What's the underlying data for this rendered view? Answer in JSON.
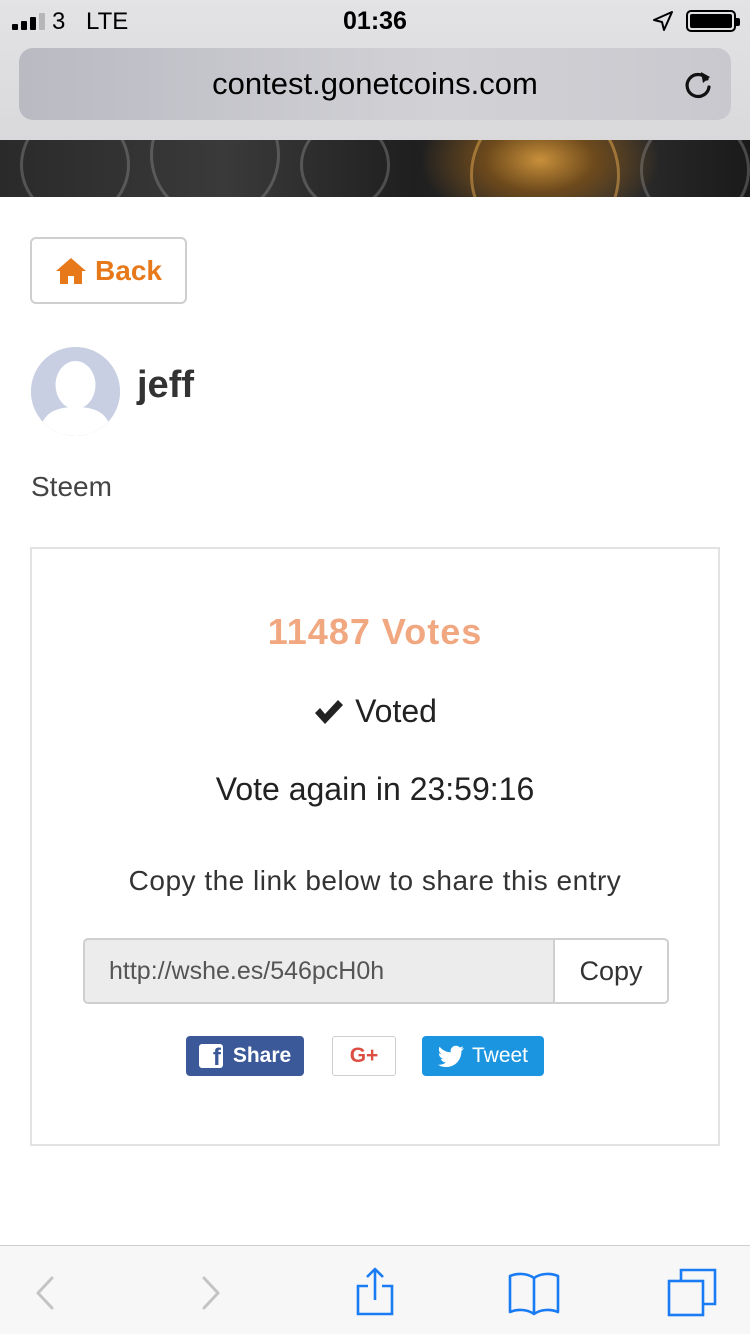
{
  "status_bar": {
    "carrier": "3",
    "network": "LTE",
    "time": "01:36"
  },
  "browser": {
    "url": "contest.gonetcoins.com"
  },
  "page": {
    "back_label": "Back",
    "user": {
      "name": "jeff"
    },
    "entry_label": "Steem",
    "card": {
      "votes": "11487 Votes",
      "voted": "Voted",
      "vote_again": "Vote again in 23:59:16",
      "share_hint": "Copy the link below to share this entry",
      "share_link": "http://wshe.es/546pcH0h",
      "copy_label": "Copy",
      "facebook_label": "Share",
      "gplus_label": "G+",
      "twitter_label": "Tweet"
    }
  },
  "colors": {
    "accent_orange": "#e8791b",
    "votes_color": "#f1a881",
    "facebook": "#3b5998",
    "twitter": "#1b95e0",
    "gplus": "#dc4e41",
    "safari_blue": "#1a7cf5"
  },
  "icons": {
    "back": "home-icon",
    "voted": "check-icon",
    "toolbar": [
      "back-arrow-icon",
      "forward-arrow-icon",
      "share-icon",
      "bookmarks-icon",
      "tabs-icon"
    ]
  }
}
